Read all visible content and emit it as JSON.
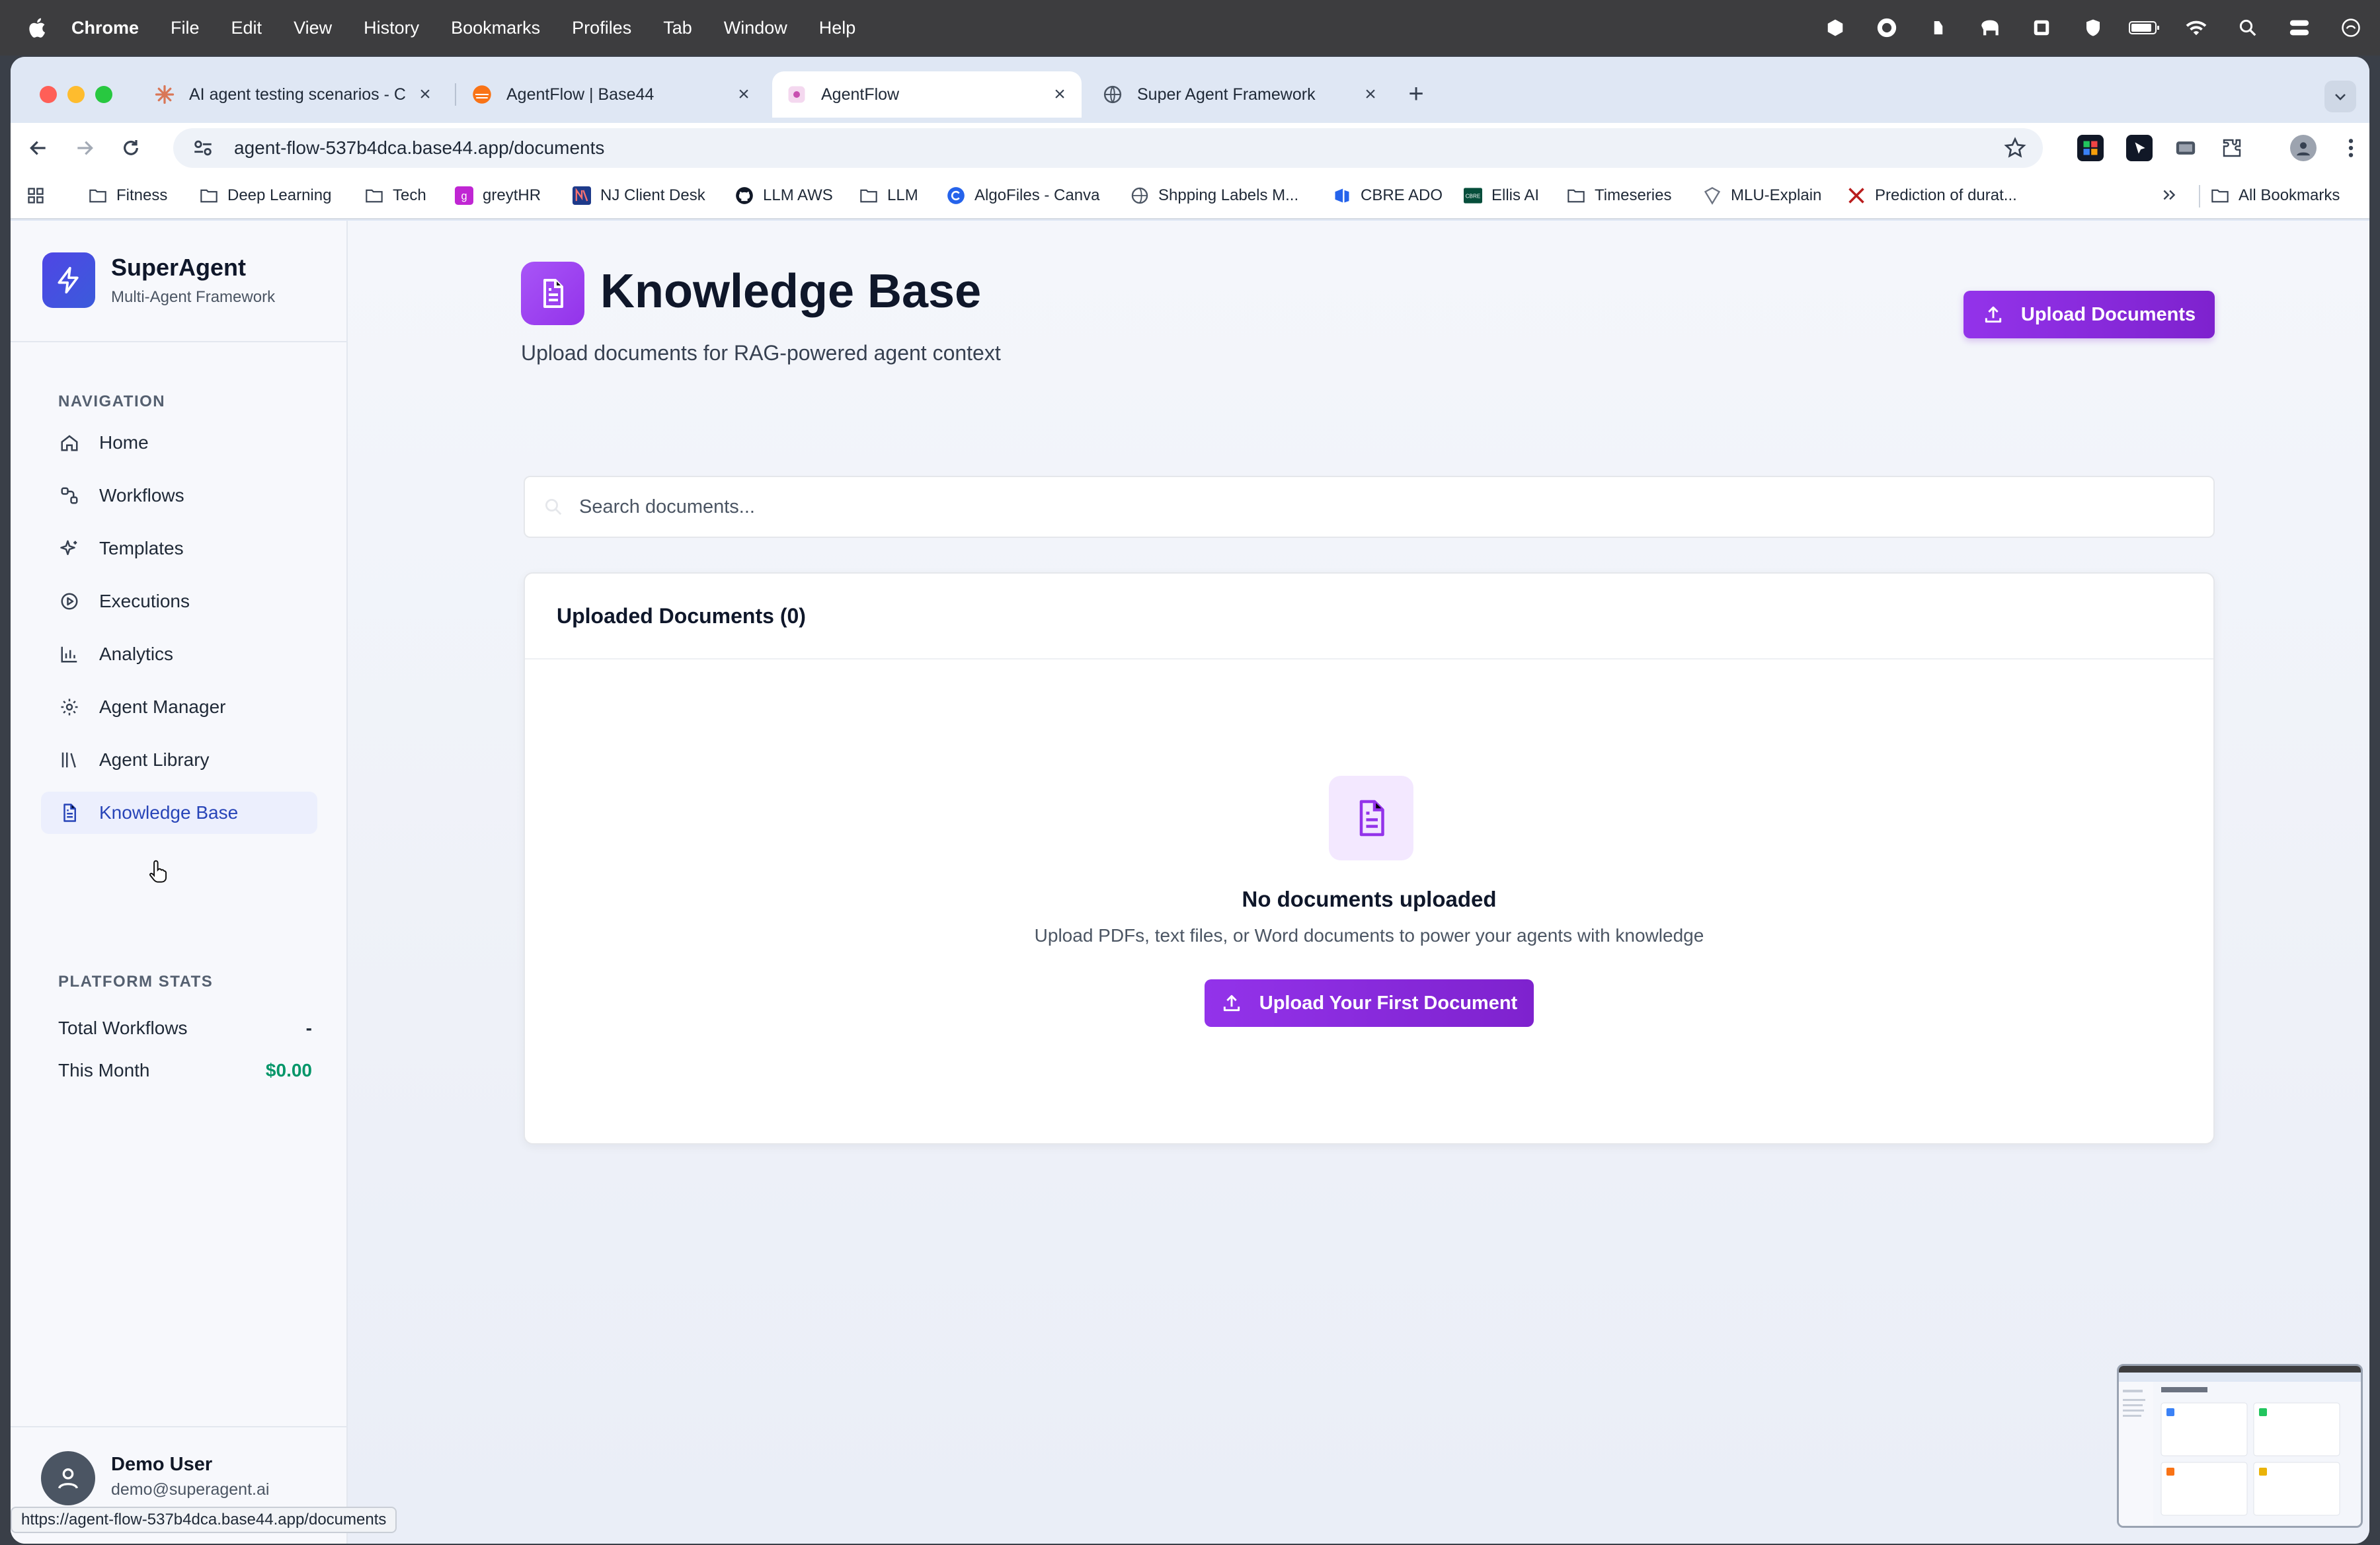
{
  "menubar": {
    "app": "Chrome",
    "items": [
      "File",
      "Edit",
      "View",
      "History",
      "Bookmarks",
      "Profiles",
      "Tab",
      "Window",
      "Help"
    ]
  },
  "tabs": [
    {
      "title": "AI agent testing scenarios - C",
      "icon": "claude-icon"
    },
    {
      "title": "AgentFlow | Base44",
      "icon": "base44-icon"
    },
    {
      "title": "AgentFlow",
      "icon": "agentflow-icon",
      "active": true
    },
    {
      "title": "Super Agent Framework",
      "icon": "globe-icon"
    }
  ],
  "address_bar": {
    "url": "agent-flow-537b4dca.base44.app/documents"
  },
  "bookmarks": [
    {
      "label": "Fitness",
      "icon": "folder-icon"
    },
    {
      "label": "Deep Learning",
      "icon": "folder-icon"
    },
    {
      "label": "Tech",
      "icon": "folder-icon"
    },
    {
      "label": "greytHR",
      "icon": "greythr-icon"
    },
    {
      "label": "NJ Client Desk",
      "icon": "nj-icon"
    },
    {
      "label": "LLM AWS",
      "icon": "github-icon"
    },
    {
      "label": "LLM",
      "icon": "folder-icon"
    },
    {
      "label": "AlgoFiles - Canva",
      "icon": "canva-icon"
    },
    {
      "label": "Shpping Labels M...",
      "icon": "globe-icon"
    },
    {
      "label": "CBRE ADO",
      "icon": "azure-devops-icon"
    },
    {
      "label": "Ellis AI",
      "icon": "cbre-icon"
    },
    {
      "label": "Timeseries",
      "icon": "folder-icon"
    },
    {
      "label": "MLU-Explain",
      "icon": "mlu-icon"
    },
    {
      "label": "Prediction of durat...",
      "icon": "arxiv-icon"
    }
  ],
  "all_bookmarks": "All Bookmarks",
  "sidebar": {
    "brand_name": "SuperAgent",
    "brand_tagline": "Multi-Agent Framework",
    "nav_heading": "NAVIGATION",
    "nav": [
      {
        "label": "Home",
        "icon": "home-icon"
      },
      {
        "label": "Workflows",
        "icon": "workflow-icon"
      },
      {
        "label": "Templates",
        "icon": "sparkles-icon"
      },
      {
        "label": "Executions",
        "icon": "play-circle-icon"
      },
      {
        "label": "Analytics",
        "icon": "bar-chart-icon"
      },
      {
        "label": "Agent Manager",
        "icon": "gear-icon"
      },
      {
        "label": "Agent Library",
        "icon": "library-icon"
      },
      {
        "label": "Knowledge Base",
        "icon": "document-icon",
        "active": true
      }
    ],
    "stats_heading": "PLATFORM STATS",
    "stats": [
      {
        "label": "Total Workflows",
        "value": "-"
      },
      {
        "label": "This Month",
        "value": "$0.00"
      }
    ],
    "user": {
      "name": "Demo User",
      "email": "demo@superagent.ai"
    }
  },
  "main": {
    "title": "Knowledge Base",
    "subtitle": "Upload documents for RAG-powered agent context",
    "upload_button": "Upload Documents",
    "search_placeholder": "Search documents...",
    "card_title": "Uploaded Documents (0)",
    "empty_title": "No documents uploaded",
    "empty_subtitle": "Upload PDFs, text files, or Word documents to power your agents with knowledge",
    "first_upload_button": "Upload Your First Document"
  },
  "status_bar_url": "https://agent-flow-537b4dca.base44.app/documents",
  "colors": {
    "accent_purple": "#9333ea",
    "active_nav": "#2845b8",
    "money_green": "#059669"
  }
}
